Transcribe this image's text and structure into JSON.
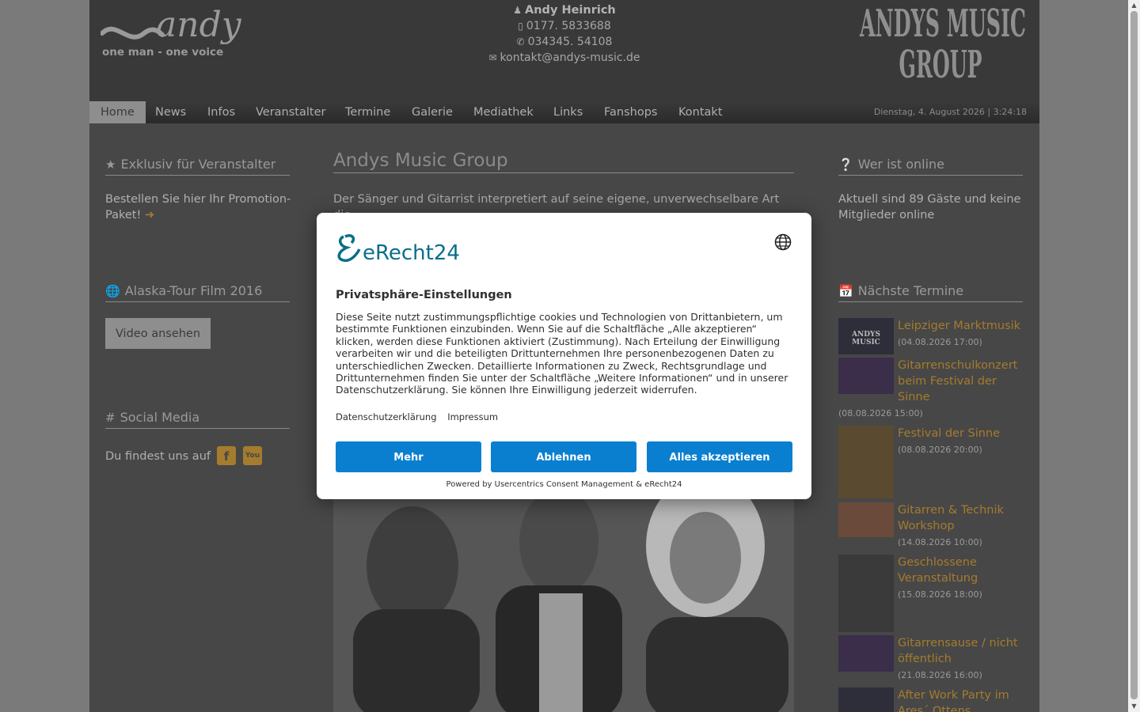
{
  "header": {
    "logo_andy": "andy",
    "logo_andy_tagline": "one man - one voice",
    "logo_group_line1": "ANDYS MUSIC",
    "logo_group_line2": "GROUP",
    "contact_name": "Andy Heinrich",
    "contact_mobile": "0177. 5833688",
    "contact_phone": "034345. 54108",
    "contact_email": "kontakt@andys-music.de"
  },
  "nav": {
    "items": [
      "Home",
      "News",
      "Infos",
      "Veranstalter",
      "Termine",
      "Galerie",
      "Mediathek",
      "Links",
      "Fanshops",
      "Kontakt"
    ],
    "active": "Home",
    "datetime": "Dienstag, 4. August 2026 | 3:24:18"
  },
  "left": {
    "promo_title": "Exklusiv für Veranstalter",
    "promo_text": "Bestellen Sie hier Ihr Promotion-Paket!",
    "tour_title": "Alaska-Tour Film 2016",
    "tour_button": "Video ansehen",
    "social_title": "Social Media",
    "social_text": "Du findest uns auf"
  },
  "main": {
    "title": "Andys Music Group",
    "intro": "Der Sänger und Gitarrist interpretiert auf seine eigene, unverwechselbare Art die"
  },
  "right": {
    "online_title": "Wer ist online",
    "online_text": "Aktuell sind 89 Gäste und keine Mitglieder online",
    "events_title": "Nächste Termine",
    "events": [
      {
        "title": "Leipziger Marktmusik",
        "date": "(04.08.2026 17:00)"
      },
      {
        "title": "Gitarrenschulkonzert beim Festival der Sinne",
        "date": "(08.08.2026 15:00)"
      },
      {
        "title": "Festival der Sinne",
        "date": "(08.08.2026 20:00)"
      },
      {
        "title": "Gitarren & Technik Workshop",
        "date": "(14.08.2026 10:00)"
      },
      {
        "title": "Geschlossene Veranstaltung",
        "date": "(15.08.2026 18:00)"
      },
      {
        "title": "Gitarrensause / nicht öffentlich",
        "date": "(21.08.2026 16:00)"
      },
      {
        "title": "After Work Party im Ares´ Ottens",
        "date": ""
      }
    ]
  },
  "consent": {
    "brand": "eRecht24",
    "heading": "Privatsphäre-Einstellungen",
    "body": "Diese Seite nutzt zustimmungspflichtige cookies und Technologien von Drittanbietern, um bestimmte Funktionen einzubinden. Wenn Sie auf die Schaltfläche „Alle akzeptieren“ klicken, werden diese Funktionen aktiviert (Zustimmung). Nach Erteilung der Einwilligung verarbeiten wir und die beteiligten Drittunternehmen Ihre personenbezogenen Daten zu unterschiedlichen Zwecken. Detaillierte Informationen zu Zweck, Rechtsgrundlage und Drittunternehmen finden Sie unter der Schaltfläche „Weitere Informationen“ und in unserer Datenschutzerklärung. Sie können Ihre Einwilligung jederzeit widerrufen.",
    "link_privacy": "Datenschutzerklärung",
    "link_imprint": "Impressum",
    "btn_more": "Mehr",
    "btn_decline": "Ablehnen",
    "btn_accept": "Alles akzeptieren",
    "powered": "Powered by Usercentrics Consent Management & eRecht24",
    "accent_color": "#0a7fd0"
  },
  "colors": {
    "page_bg": "#474747",
    "header_bg": "#393939",
    "accent": "#a57b2e"
  }
}
